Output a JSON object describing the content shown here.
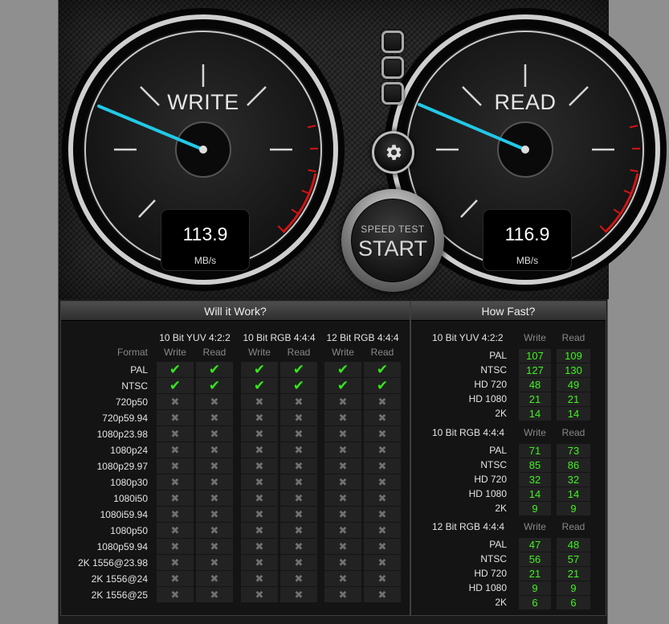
{
  "write_gauge": {
    "title": "WRITE",
    "value": "113.9",
    "unit": "MB/s"
  },
  "read_gauge": {
    "title": "READ",
    "value": "116.9",
    "unit": "MB/s"
  },
  "start_button": {
    "small_label": "SPEED TEST",
    "big_label": "START"
  },
  "icons": {
    "settings": "gear-icon",
    "toggle": "square-button"
  },
  "colors": {
    "needle": "#22c8e6",
    "redline": "#d21414",
    "check": "#35e81c",
    "cross": "#707070",
    "number": "#3ff220"
  },
  "will_it_work": {
    "title": "Will it Work?",
    "format_label": "Format",
    "groups": [
      {
        "name": "10 Bit YUV 4:2:2",
        "write": "Write",
        "read": "Read"
      },
      {
        "name": "10 Bit RGB 4:4:4",
        "write": "Write",
        "read": "Read"
      },
      {
        "name": "12 Bit RGB 4:4:4",
        "write": "Write",
        "read": "Read"
      }
    ],
    "rows": [
      {
        "format": "PAL",
        "ok": [
          true,
          true,
          true,
          true,
          true,
          true
        ]
      },
      {
        "format": "NTSC",
        "ok": [
          true,
          true,
          true,
          true,
          true,
          true
        ]
      },
      {
        "format": "720p50",
        "ok": [
          false,
          false,
          false,
          false,
          false,
          false
        ]
      },
      {
        "format": "720p59.94",
        "ok": [
          false,
          false,
          false,
          false,
          false,
          false
        ]
      },
      {
        "format": "1080p23.98",
        "ok": [
          false,
          false,
          false,
          false,
          false,
          false
        ]
      },
      {
        "format": "1080p24",
        "ok": [
          false,
          false,
          false,
          false,
          false,
          false
        ]
      },
      {
        "format": "1080p29.97",
        "ok": [
          false,
          false,
          false,
          false,
          false,
          false
        ]
      },
      {
        "format": "1080p30",
        "ok": [
          false,
          false,
          false,
          false,
          false,
          false
        ]
      },
      {
        "format": "1080i50",
        "ok": [
          false,
          false,
          false,
          false,
          false,
          false
        ]
      },
      {
        "format": "1080i59.94",
        "ok": [
          false,
          false,
          false,
          false,
          false,
          false
        ]
      },
      {
        "format": "1080p50",
        "ok": [
          false,
          false,
          false,
          false,
          false,
          false
        ]
      },
      {
        "format": "1080p59.94",
        "ok": [
          false,
          false,
          false,
          false,
          false,
          false
        ]
      },
      {
        "format": "2K 1556@23.98",
        "ok": [
          false,
          false,
          false,
          false,
          false,
          false
        ]
      },
      {
        "format": "2K 1556@24",
        "ok": [
          false,
          false,
          false,
          false,
          false,
          false
        ]
      },
      {
        "format": "2K 1556@25",
        "ok": [
          false,
          false,
          false,
          false,
          false,
          false
        ]
      }
    ]
  },
  "how_fast": {
    "title": "How Fast?",
    "groups": [
      {
        "name": "10 Bit YUV 4:2:2",
        "write": "Write",
        "read": "Read",
        "rows": [
          {
            "format": "PAL",
            "write": "107",
            "read": "109"
          },
          {
            "format": "NTSC",
            "write": "127",
            "read": "130"
          },
          {
            "format": "HD 720",
            "write": "48",
            "read": "49"
          },
          {
            "format": "HD 1080",
            "write": "21",
            "read": "21"
          },
          {
            "format": "2K",
            "write": "14",
            "read": "14"
          }
        ]
      },
      {
        "name": "10 Bit RGB 4:4:4",
        "write": "Write",
        "read": "Read",
        "rows": [
          {
            "format": "PAL",
            "write": "71",
            "read": "73"
          },
          {
            "format": "NTSC",
            "write": "85",
            "read": "86"
          },
          {
            "format": "HD 720",
            "write": "32",
            "read": "32"
          },
          {
            "format": "HD 1080",
            "write": "14",
            "read": "14"
          },
          {
            "format": "2K",
            "write": "9",
            "read": "9"
          }
        ]
      },
      {
        "name": "12 Bit RGB 4:4:4",
        "write": "Write",
        "read": "Read",
        "rows": [
          {
            "format": "PAL",
            "write": "47",
            "read": "48"
          },
          {
            "format": "NTSC",
            "write": "56",
            "read": "57"
          },
          {
            "format": "HD 720",
            "write": "21",
            "read": "21"
          },
          {
            "format": "HD 1080",
            "write": "9",
            "read": "9"
          },
          {
            "format": "2K",
            "write": "6",
            "read": "6"
          }
        ]
      }
    ]
  }
}
